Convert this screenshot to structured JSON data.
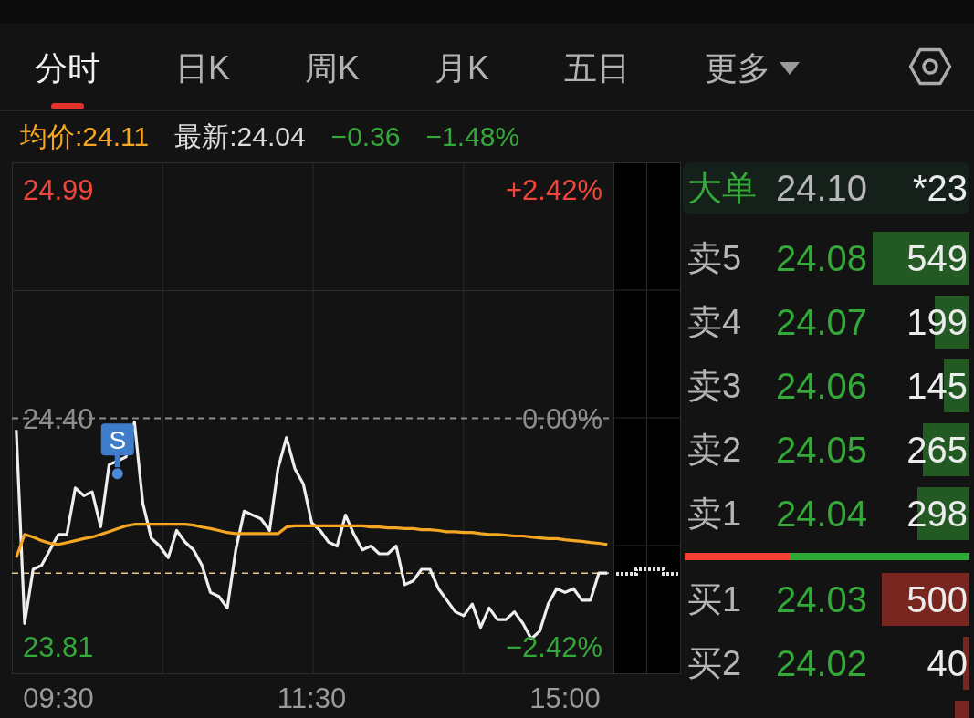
{
  "tabs": [
    {
      "label": "分时",
      "selected": true,
      "menu": false
    },
    {
      "label": "日K",
      "selected": false,
      "menu": false
    },
    {
      "label": "周K",
      "selected": false,
      "menu": false
    },
    {
      "label": "月K",
      "selected": false,
      "menu": false
    },
    {
      "label": "五日",
      "selected": false,
      "menu": false
    },
    {
      "label": "更多",
      "selected": false,
      "menu": true
    }
  ],
  "quote_bar": [
    {
      "text": "均价:24.11",
      "color": "#f5a623"
    },
    {
      "text": "最新:24.04",
      "color": "#dcdcdc"
    },
    {
      "text": "−0.36",
      "color": "#35a83a"
    },
    {
      "text": "−1.48%",
      "color": "#35a83a"
    }
  ],
  "intraday_chart": {
    "chart_data": [
      {
        "type": "line",
        "categories": [
          null,
          null,
          null,
          null,
          null,
          "09:30",
          null,
          null,
          null,
          null,
          null,
          null,
          null,
          null,
          null,
          null,
          null,
          null,
          null,
          null,
          null,
          null,
          null,
          null,
          null,
          null,
          null,
          null,
          null,
          null,
          null,
          null,
          null,
          null,
          null,
          "11:30",
          null,
          null,
          null,
          null,
          null,
          null,
          null,
          null,
          null,
          null,
          null,
          null,
          null,
          null,
          null,
          null,
          null,
          null,
          null,
          null,
          null,
          null,
          null,
          null,
          null,
          null,
          null,
          null,
          null,
          "15:00",
          null,
          null,
          null,
          null,
          null
        ],
        "series": [
          {
            "color": "#eeeeee",
            "values": [
              24.37,
              23.87,
              24.01,
              24.02,
              24.06,
              24.1,
              24.1,
              24.22,
              24.2,
              24.21,
              24.12,
              24.28,
              24.29,
              24.3,
              24.39,
              24.18,
              24.09,
              24.07,
              24.04,
              24.11,
              24.08,
              24.06,
              24.02,
              23.95,
              23.94,
              23.91,
              24.06,
              24.16,
              24.15,
              24.14,
              24.11,
              24.27,
              24.35,
              24.27,
              24.23,
              24.13,
              24.11,
              24.08,
              24.07,
              24.15,
              24.1,
              24.06,
              24.07,
              24.05,
              24.05,
              24.07,
              23.97,
              23.98,
              24.01,
              24.01,
              23.96,
              23.93,
              23.9,
              23.89,
              23.92,
              23.86,
              23.91,
              23.88,
              23.88,
              23.9,
              23.87,
              23.83,
              23.85,
              23.92,
              23.96,
              23.95,
              23.96,
              23.93,
              23.93,
              24.0,
              24.0
            ]
          },
          {
            "color": "#f5a623",
            "values": [
              24.04,
              24.1,
              24.093,
              24.084,
              24.077,
              24.074,
              24.079,
              24.084,
              24.089,
              24.093,
              24.1,
              24.107,
              24.115,
              24.122,
              24.126,
              24.126,
              24.126,
              24.126,
              24.126,
              24.126,
              24.126,
              24.124,
              24.119,
              24.115,
              24.11,
              24.105,
              24.102,
              24.102,
              24.102,
              24.102,
              24.102,
              24.102,
              24.119,
              24.122,
              24.122,
              24.122,
              24.122,
              24.122,
              24.122,
              24.122,
              24.122,
              24.122,
              24.119,
              24.119,
              24.117,
              24.117,
              24.115,
              24.115,
              24.112,
              24.112,
              24.11,
              24.107,
              24.107,
              24.105,
              24.105,
              24.102,
              24.1,
              24.1,
              24.098,
              24.096,
              24.096,
              24.093,
              24.091,
              24.089,
              24.089,
              24.086,
              24.084,
              24.082,
              24.079,
              24.077,
              24.074
            ]
          }
        ],
        "ylim": [
          23.74,
          25.06
        ],
        "yticks": [
          {
            "value": 24.99,
            "label": "24.99"
          },
          {
            "value": 24.4,
            "label": "24.40"
          },
          {
            "value": 23.81,
            "label": "23.81"
          }
        ],
        "y2lim": [
          -2.705,
          2.705
        ],
        "y2ticks": [
          {
            "value": 2.42,
            "label": "+2.42%"
          },
          {
            "value": 0,
            "label": "0.00%"
          },
          {
            "value": -2.42,
            "label": "−2.42%"
          }
        ],
        "grid": true,
        "ref_lines": [
          {
            "axis": "y",
            "value": 24.4,
            "color": "#8c8c8c",
            "line_style": "dashed"
          },
          {
            "axis": "y",
            "value": 24.0,
            "color": "#f0c58c",
            "line_style": "dashed"
          }
        ],
        "annotations": [
          "S"
        ]
      }
    ]
  },
  "order_book": {
    "big_order": {
      "label": "大单",
      "price": "24.10",
      "volume": "*23"
    },
    "asks": [
      {
        "label": "卖5",
        "price": "24.08",
        "volume": "549",
        "level": 1.0
      },
      {
        "label": "卖4",
        "price": "24.07",
        "volume": "199",
        "level": 0.36
      },
      {
        "label": "卖3",
        "price": "24.06",
        "volume": "145",
        "level": 0.26
      },
      {
        "label": "卖2",
        "price": "24.05",
        "volume": "265",
        "level": 0.48
      },
      {
        "label": "卖1",
        "price": "24.04",
        "volume": "298",
        "level": 0.54
      }
    ],
    "ratio": {
      "level": 0.37
    },
    "bids": [
      {
        "label": "买1",
        "price": "24.03",
        "volume": "500",
        "level": 0.91
      },
      {
        "label": "买2",
        "price": "24.02",
        "volume": "40",
        "level": 0.07
      },
      {
        "level": 0.15
      }
    ]
  }
}
